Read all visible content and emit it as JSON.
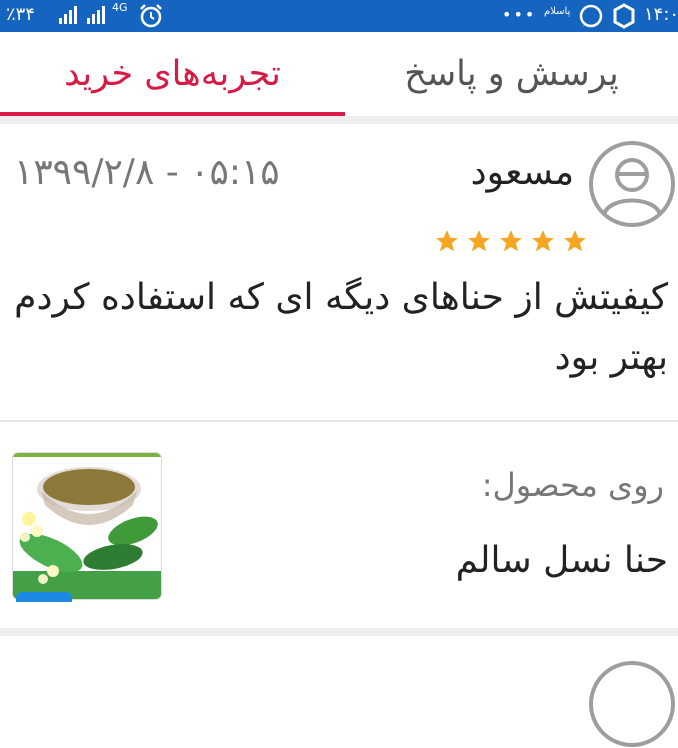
{
  "status_bar": {
    "battery": "٪۳۴",
    "network": "4G",
    "time": "۱۴:۰",
    "dots": "•••",
    "notification_text": "پاسلام"
  },
  "tabs": [
    {
      "label": "تجربه‌های خرید",
      "active": true
    },
    {
      "label": "پرسش و پاسخ",
      "active": false
    }
  ],
  "review": {
    "user_name": "مسعود",
    "date": "۰۵:۱۵ - ۱۳۹۹/۲/۸",
    "rating": 5,
    "text": "کیفیتش از حناهای دیگه ای که استفاده کردم بهتر بود"
  },
  "product": {
    "label": "روی محصول:",
    "name": "حنا نسل سالم"
  },
  "colors": {
    "status_bar": "#1565c0",
    "accent": "#d81b45",
    "star": "#f5a623",
    "divider": "#eeeeee"
  }
}
